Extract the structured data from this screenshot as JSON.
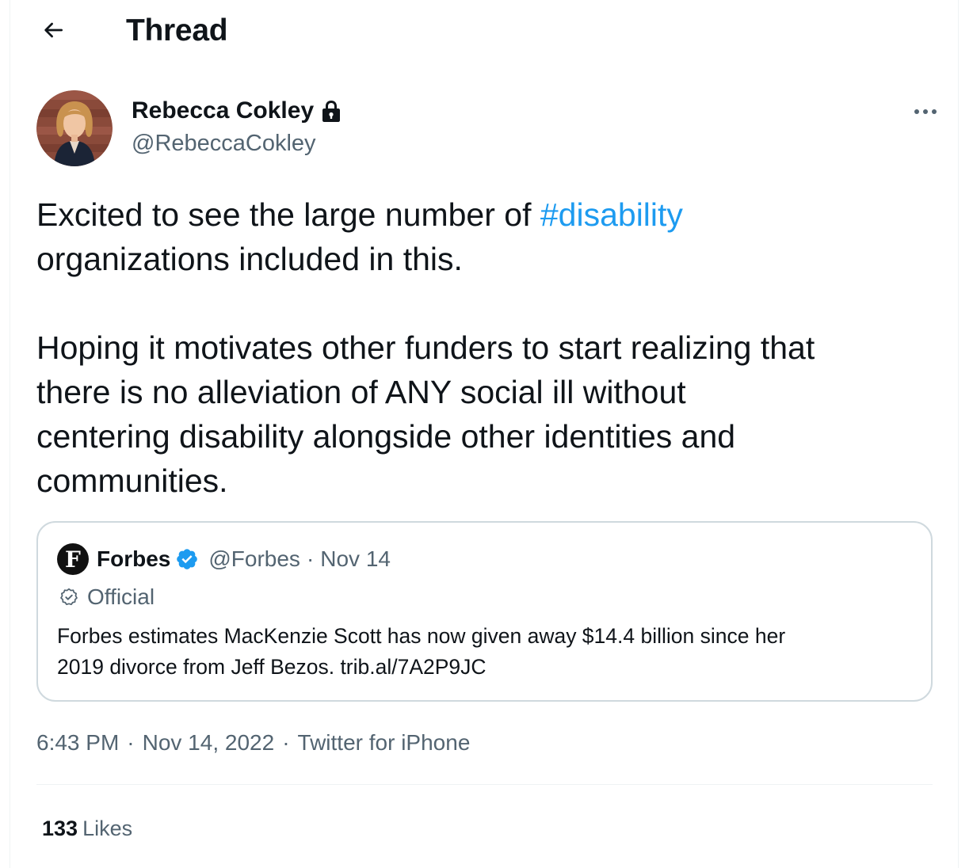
{
  "header": {
    "title": "Thread",
    "back_icon": "arrow-left-icon"
  },
  "author": {
    "name": "Rebecca Cokley",
    "handle": "@RebeccaCokley",
    "protected_icon": "lock-icon",
    "more_icon": "more-horizontal-icon"
  },
  "tweet": {
    "para1_before": "Excited to see the large number of ",
    "hashtag": "#disability",
    "para1_line2": "organizations included in this.",
    "para2_line1": "Hoping it motivates other funders to start realizing that",
    "para2_line2": "there is no alleviation of ANY social ill without",
    "para2_line3": "centering disability alongside other identities and",
    "para2_line4": "communities."
  },
  "quote": {
    "logo_letter": "F",
    "name": "Forbes",
    "handle": "@Forbes",
    "dot": "·",
    "date": "Nov 14",
    "official_label": "Official",
    "text_line1": "Forbes estimates MacKenzie Scott has now given away $14.4 billion since her",
    "text_line2": "2019 divorce from Jeff Bezos. trib.al/7A2P9JC"
  },
  "meta": {
    "time": "6:43 PM",
    "sep": "·",
    "date": "Nov 14, 2022",
    "source": "Twitter for iPhone"
  },
  "likes": {
    "count": "133",
    "label": "Likes"
  },
  "colors": {
    "accent": "#1d9bf0",
    "secondary_text": "#536471",
    "primary_text": "#0f1419",
    "border": "#cfd9de"
  }
}
